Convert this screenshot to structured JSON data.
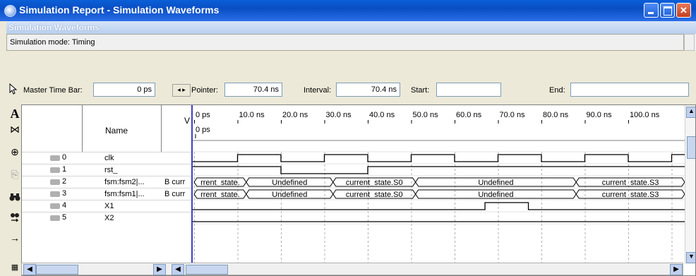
{
  "window": {
    "title": "Simulation Report - Simulation Waveforms"
  },
  "section": {
    "header": "Simulation Waveforms",
    "mode_text": "Simulation mode: Timing"
  },
  "toolbar": {
    "master_time_bar_label": "Master Time Bar:",
    "master_time_bar_value": "0 ps",
    "nav_arrows": "◂ ▸",
    "pointer_label": "Pointer:",
    "pointer_value": "70.4 ns",
    "interval_label": "Interval:",
    "interval_value": "70.4 ns",
    "start_label": "Start:",
    "start_value": "",
    "end_label": "End:",
    "end_value": ""
  },
  "columns": {
    "name": "Name",
    "value": "V"
  },
  "signals": [
    {
      "index": "0",
      "name": "clk",
      "value": "",
      "kind": "input"
    },
    {
      "index": "1",
      "name": "rst_",
      "value": "",
      "kind": "input"
    },
    {
      "index": "2",
      "name": "fsm:fsm2|...",
      "value": "B curr",
      "kind": "bus"
    },
    {
      "index": "3",
      "name": "fsm:fsm1|...",
      "value": "B curr",
      "kind": "bus"
    },
    {
      "index": "4",
      "name": "X1",
      "value": "",
      "kind": "input"
    },
    {
      "index": "5",
      "name": "X2",
      "value": "",
      "kind": "input"
    }
  ],
  "timeline": {
    "ticks": [
      "0 ps",
      "10.0 ns",
      "20.0 ns",
      "30.0 ns",
      "40.0 ns",
      "50.0 ns",
      "60.0 ns",
      "70.0 ns",
      "80.0 ns",
      "90.0 ns",
      "100.0 ns"
    ],
    "marker_label": "0 ps"
  },
  "bus_labels": {
    "seg1": "rrent_state.",
    "seg2": "Undefined",
    "seg3": "current_state.S0",
    "seg4": "Undefined",
    "seg5": "current_state.S3"
  },
  "icons": {
    "app": "simulation-icon",
    "pointer": "arrow-pointer-icon",
    "text": "text-tool-icon",
    "waveform_edit": "waveform-editor-icon",
    "zoom": "zoom-icon",
    "copy": "copy-icon",
    "find": "binoculars-icon",
    "find_next": "find-next-icon",
    "goto": "right-arrow-icon",
    "sort": "sort-icon"
  }
}
